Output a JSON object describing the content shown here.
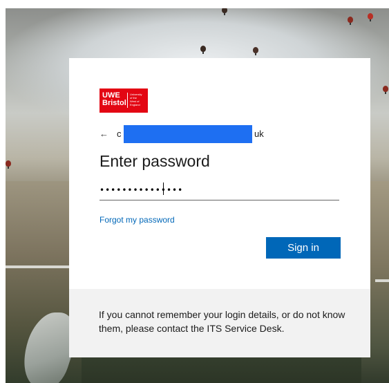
{
  "background": {
    "description_colors": [
      "#8d8f8c",
      "#c9cbc6",
      "#5a5a46"
    ],
    "balloons": [
      {
        "color": "#8a2a1f"
      },
      {
        "color": "#b82f25"
      },
      {
        "color": "#8a2a1f"
      },
      {
        "color": "#3a2a22"
      },
      {
        "color": "#4a3128"
      },
      {
        "color": "#8a2a1f"
      },
      {
        "color": "#3a2a22"
      }
    ]
  },
  "logo": {
    "main": "UWE\nBristol",
    "sub": "University\nof the\nWest of\nEngland",
    "color": "#e30613"
  },
  "account": {
    "back_icon": "←",
    "email_start": "c",
    "email_end": "uk"
  },
  "heading": "Enter password",
  "password": {
    "value": "•••••••••••••••",
    "type": "password"
  },
  "forgot_link": "Forgot my password",
  "signin_button": "Sign in",
  "footer": {
    "text": "If you cannot remember your login details, or do not know them, please contact the ITS Service Desk."
  },
  "colors": {
    "accent": "#0067b8",
    "redaction": "#1e6ff2",
    "footer_bg": "#f2f2f2"
  }
}
